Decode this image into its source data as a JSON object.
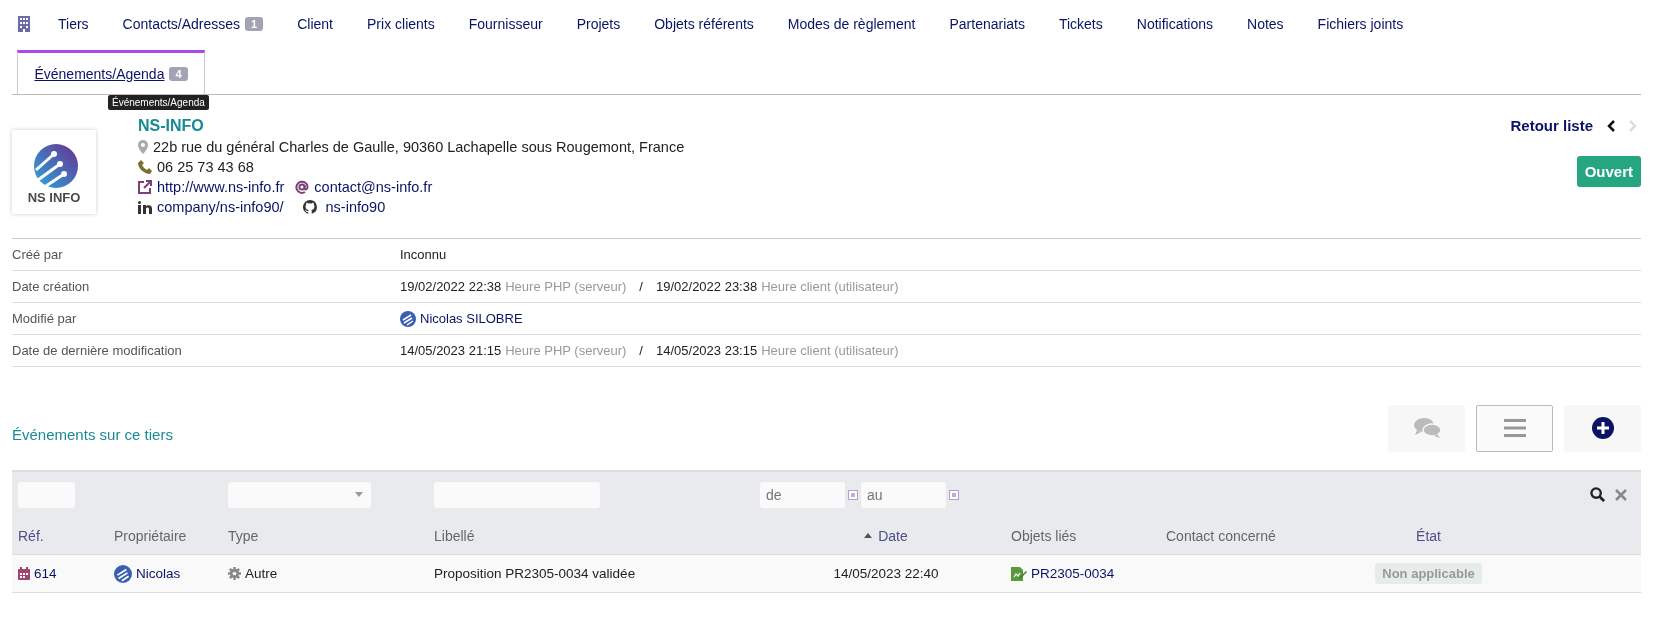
{
  "tabs": [
    {
      "label": "Tiers",
      "selected": false
    },
    {
      "label": "Contacts/Adresses",
      "badge": "1",
      "selected": false
    },
    {
      "label": "Client",
      "selected": false
    },
    {
      "label": "Prix clients",
      "selected": false
    },
    {
      "label": "Fournisseur",
      "selected": false
    },
    {
      "label": "Projets",
      "selected": false
    },
    {
      "label": "Objets référents",
      "selected": false
    },
    {
      "label": "Modes de règlement",
      "selected": false
    },
    {
      "label": "Partenariats",
      "selected": false
    },
    {
      "label": "Tickets",
      "selected": false
    },
    {
      "label": "Notifications",
      "selected": false
    },
    {
      "label": "Notes",
      "selected": false
    },
    {
      "label": "Fichiers joints",
      "selected": false
    },
    {
      "label": "Événements/Agenda",
      "badge": "4",
      "selected": true
    }
  ],
  "tooltip": "Événements/Agenda",
  "company": {
    "logo_text": "NS INFO",
    "name": "NS-INFO",
    "address": "22b rue du général Charles de Gaulle, 90360 Lachapelle sous Rougemont, France",
    "phone": "06 25 73 43 68",
    "website": "http://www.ns-info.fr",
    "email": "contact@ns-info.fr",
    "linkedin": "company/ns-info90/",
    "github": "ns-info90"
  },
  "nav": {
    "back": "Retour liste",
    "prev_enabled": true,
    "next_enabled": false
  },
  "status": "Ouvert",
  "info": [
    {
      "kind": "text",
      "label": "Créé par",
      "value": "Inconnu"
    },
    {
      "kind": "dates",
      "label": "Date création",
      "server_date": "19/02/2022 22:38",
      "server_note": "Heure PHP (serveur)",
      "separator": "/",
      "client_date": "19/02/2022 23:38",
      "client_note": "Heure client (utilisateur)"
    },
    {
      "kind": "user",
      "label": "Modifié par",
      "value": "Nicolas SILOBRE"
    },
    {
      "kind": "dates",
      "label": "Date de dernière modification",
      "server_date": "14/05/2023 21:15",
      "server_note": "Heure PHP (serveur)",
      "separator": "/",
      "client_date": "14/05/2023 23:15",
      "client_note": "Heure client (utilisateur)"
    }
  ],
  "events": {
    "title": "Événements sur ce tiers",
    "filters": [
      {
        "kind": "text"
      },
      {
        "kind": "none"
      },
      {
        "kind": "select"
      },
      {
        "kind": "text"
      },
      {
        "kind": "daterange",
        "from_placeholder": "de",
        "to_placeholder": "au"
      }
    ],
    "columns": [
      {
        "label": "Réf.",
        "sortable": true,
        "sorted": false
      },
      {
        "label": "Propriétaire",
        "sortable": false,
        "sorted": false
      },
      {
        "label": "Type",
        "sortable": false,
        "sorted": false
      },
      {
        "label": "Libellé",
        "sortable": false,
        "sorted": false
      },
      {
        "label": "Date",
        "sortable": true,
        "sorted": true
      },
      {
        "label": "Objets liés",
        "sortable": false,
        "sorted": false
      },
      {
        "label": "Contact concerné",
        "sortable": false,
        "sorted": false
      },
      {
        "label": "État",
        "sortable": true,
        "sorted": false
      }
    ],
    "rows": [
      {
        "ref": "614",
        "owner": "Nicolas",
        "type": "Autre",
        "label": "Proposition PR2305-0034 validée",
        "date": "14/05/2023 22:40",
        "linked": "PR2305-0034",
        "status": "Non applicable"
      }
    ]
  }
}
